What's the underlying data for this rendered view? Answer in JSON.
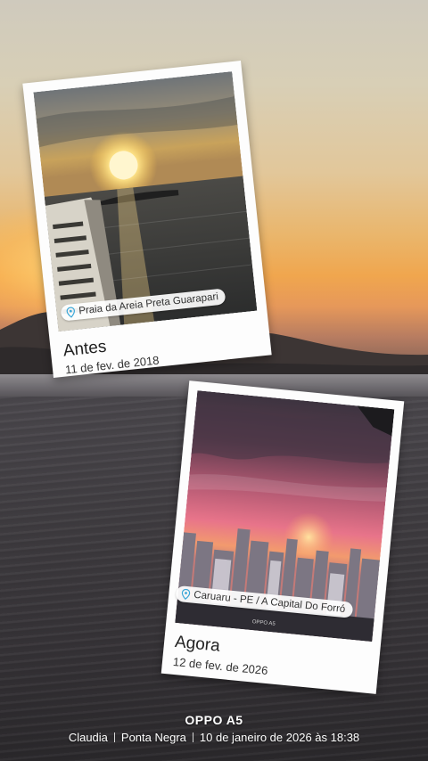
{
  "cards": [
    {
      "title": "Antes",
      "date": "11 de fev. de 2018",
      "location": "Praia da Areia Preta Guarapari"
    },
    {
      "title": "Agora",
      "date": "12 de fev. de 2026",
      "location": "Caruaru - PE / A Capital Do Forró",
      "photo_watermark": "OPPO A5"
    }
  ],
  "footer": {
    "device": "OPPO A5",
    "author": "Claudia",
    "place": "Ponta Negra",
    "datetime": "10 de janeiro de 2026 às 18:38"
  },
  "icons": [
    "location-pin-icon"
  ],
  "colors": {
    "accent_pin": "#3aa7d8"
  }
}
